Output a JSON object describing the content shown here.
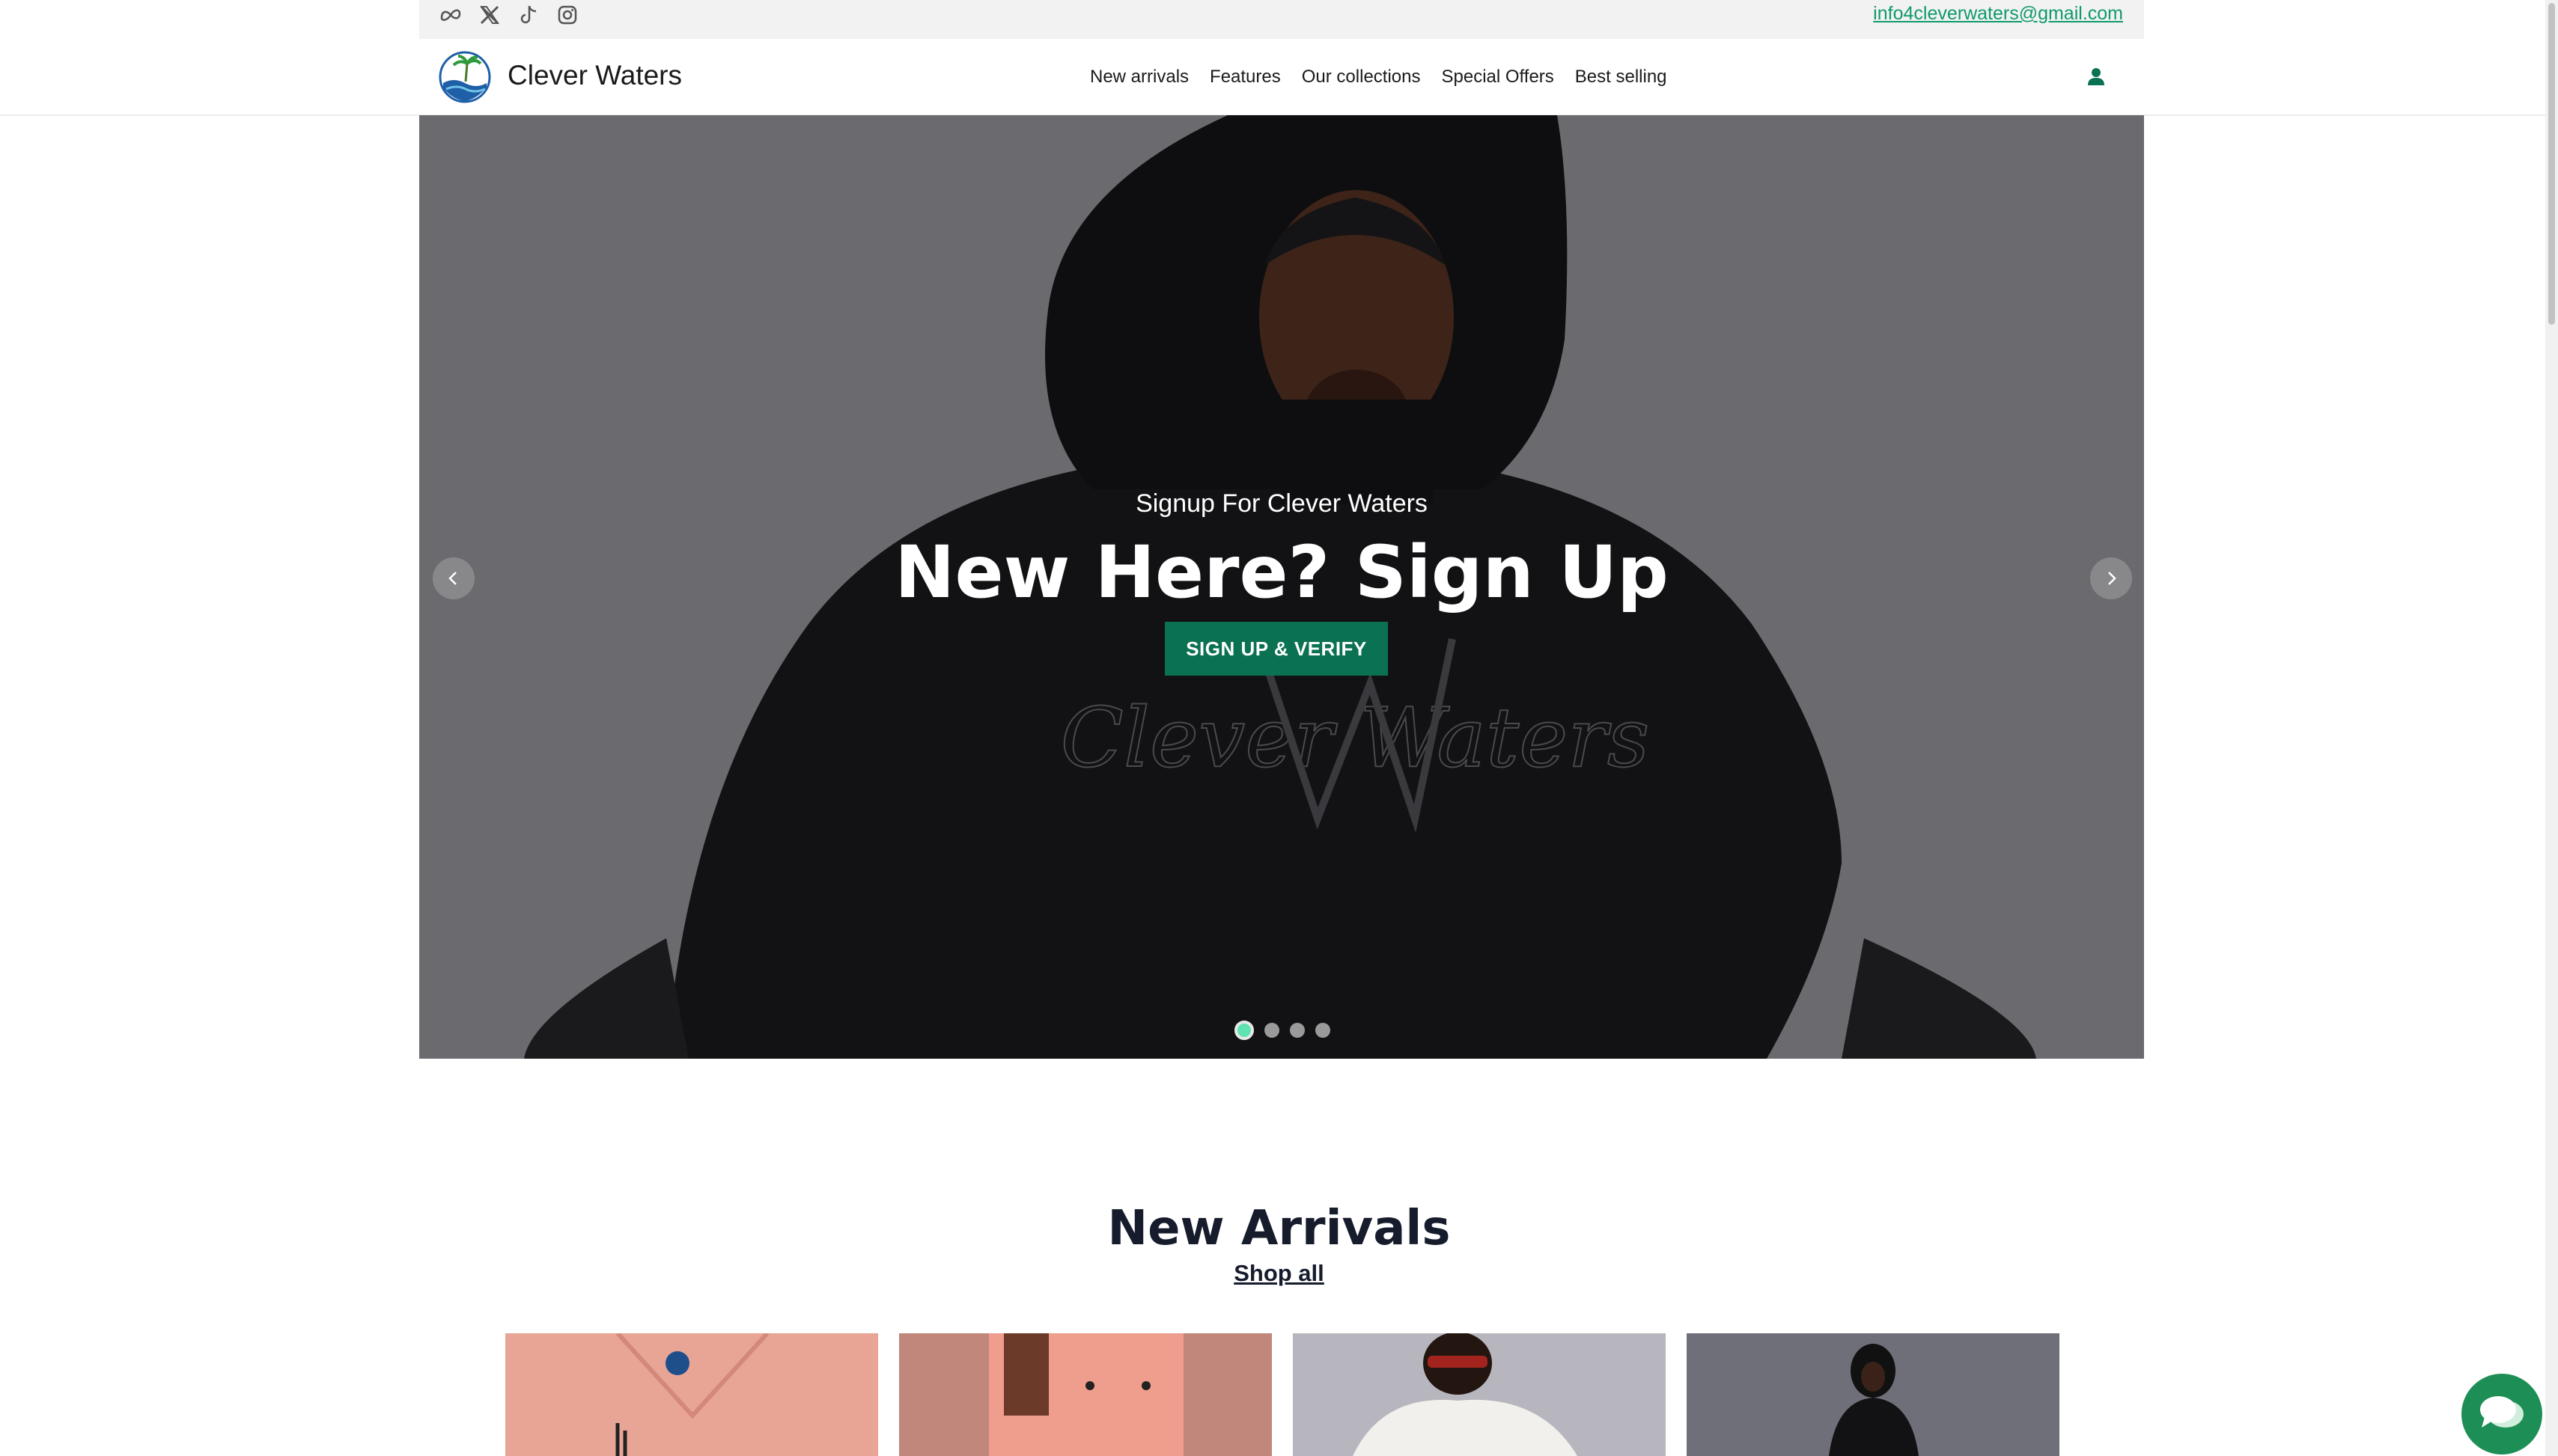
{
  "topbar": {
    "socials": [
      "meta-icon",
      "x-icon",
      "tiktok-icon",
      "instagram-icon"
    ],
    "email": "info4cleverwaters@gmail.com"
  },
  "header": {
    "brand": "Clever Waters",
    "nav": [
      "New arrivals",
      "Features",
      "Our collections",
      "Special Offers",
      "Best selling"
    ],
    "account_icon": "user-icon"
  },
  "hero": {
    "subtitle": "Signup For Clever Waters",
    "title": "New Here? Sign Up",
    "button": "SIGN UP & VERIFY",
    "slide_count": 4,
    "active_slide": 1
  },
  "new_arrivals": {
    "title": "New Arrivals",
    "link": "Shop all"
  },
  "colors": {
    "accent": "#0b7153",
    "email_link": "#0f9a6b",
    "chat": "#1d8e55",
    "active_dot": "#5fe3b0"
  },
  "chat_icon": "chat-bubble-icon"
}
